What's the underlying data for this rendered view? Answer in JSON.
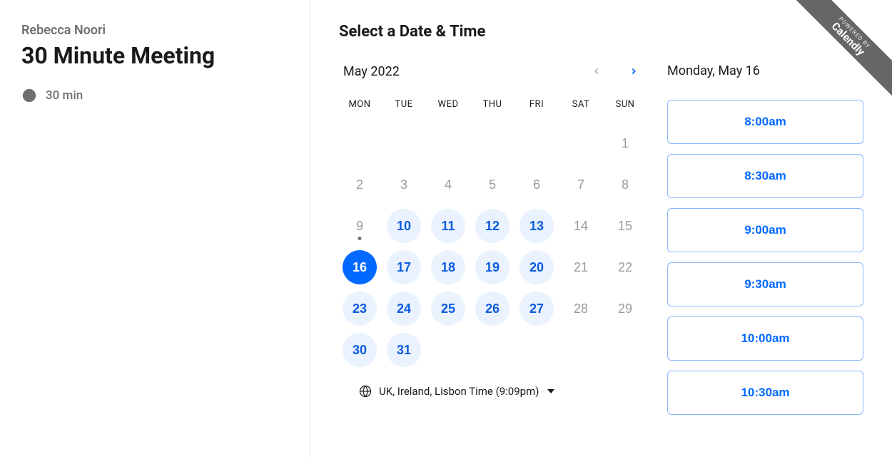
{
  "host": {
    "name": "Rebecca Noori"
  },
  "meeting": {
    "title": "30 Minute Meeting",
    "duration_label": "30 min"
  },
  "page": {
    "select_title": "Select a Date & Time"
  },
  "calendar": {
    "month_label": "May 2022",
    "weekdays": [
      "MON",
      "TUE",
      "WED",
      "THU",
      "FRI",
      "SAT",
      "SUN"
    ],
    "weeks": [
      [
        {
          "n": "",
          "state": "empty"
        },
        {
          "n": "",
          "state": "empty"
        },
        {
          "n": "",
          "state": "empty"
        },
        {
          "n": "",
          "state": "empty"
        },
        {
          "n": "",
          "state": "empty"
        },
        {
          "n": "",
          "state": "empty"
        },
        {
          "n": "1",
          "state": "disabled"
        }
      ],
      [
        {
          "n": "2",
          "state": "disabled"
        },
        {
          "n": "3",
          "state": "disabled"
        },
        {
          "n": "4",
          "state": "disabled"
        },
        {
          "n": "5",
          "state": "disabled"
        },
        {
          "n": "6",
          "state": "disabled"
        },
        {
          "n": "7",
          "state": "disabled"
        },
        {
          "n": "8",
          "state": "disabled"
        }
      ],
      [
        {
          "n": "9",
          "state": "disabled",
          "today": true
        },
        {
          "n": "10",
          "state": "available"
        },
        {
          "n": "11",
          "state": "available"
        },
        {
          "n": "12",
          "state": "available"
        },
        {
          "n": "13",
          "state": "available"
        },
        {
          "n": "14",
          "state": "disabled"
        },
        {
          "n": "15",
          "state": "disabled"
        }
      ],
      [
        {
          "n": "16",
          "state": "selected"
        },
        {
          "n": "17",
          "state": "available"
        },
        {
          "n": "18",
          "state": "available"
        },
        {
          "n": "19",
          "state": "available"
        },
        {
          "n": "20",
          "state": "available"
        },
        {
          "n": "21",
          "state": "disabled"
        },
        {
          "n": "22",
          "state": "disabled"
        }
      ],
      [
        {
          "n": "23",
          "state": "available"
        },
        {
          "n": "24",
          "state": "available"
        },
        {
          "n": "25",
          "state": "available"
        },
        {
          "n": "26",
          "state": "available"
        },
        {
          "n": "27",
          "state": "available"
        },
        {
          "n": "28",
          "state": "disabled"
        },
        {
          "n": "29",
          "state": "disabled"
        }
      ],
      [
        {
          "n": "30",
          "state": "available"
        },
        {
          "n": "31",
          "state": "available"
        },
        {
          "n": "",
          "state": "empty"
        },
        {
          "n": "",
          "state": "empty"
        },
        {
          "n": "",
          "state": "empty"
        },
        {
          "n": "",
          "state": "empty"
        },
        {
          "n": "",
          "state": "empty"
        }
      ]
    ]
  },
  "timezone": {
    "label": "UK, Ireland, Lisbon Time (9:09pm)"
  },
  "selected": {
    "date_label": "Monday, May 16"
  },
  "slots": [
    "8:00am",
    "8:30am",
    "9:00am",
    "9:30am",
    "10:00am",
    "10:30am"
  ],
  "ribbon": {
    "small": "POWERED BY",
    "big": "Calendly"
  }
}
